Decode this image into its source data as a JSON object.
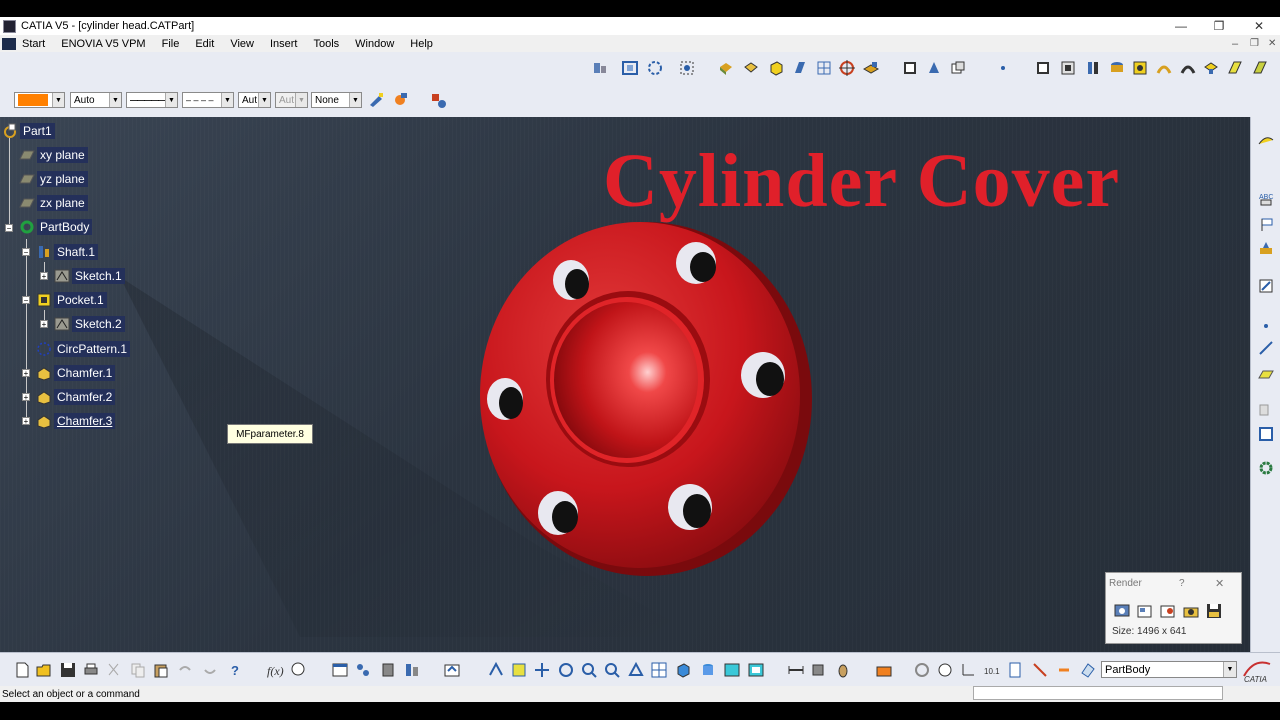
{
  "window": {
    "title": "CATIA V5 - [cylinder head.CATPart]",
    "controls": [
      "—",
      "❐",
      "✕"
    ],
    "doc_controls": [
      "–",
      "❐",
      "✕"
    ]
  },
  "menu": [
    "Start",
    "ENOVIA V5 VPM",
    "File",
    "Edit",
    "View",
    "Insert",
    "Tools",
    "Window",
    "Help"
  ],
  "graphic_props": {
    "color": "#ff8000",
    "transparency": "Auto",
    "linetype_solid": "——————",
    "linetype_dashed": "– – – –",
    "thickness": "Aut",
    "point_symbol": "Aut",
    "layer": "None"
  },
  "tree": {
    "root": "Part1",
    "items": [
      {
        "label": "xy plane",
        "icon": "plane-icon"
      },
      {
        "label": "yz plane",
        "icon": "plane-icon"
      },
      {
        "label": "zx plane",
        "icon": "plane-icon"
      },
      {
        "label": "PartBody",
        "icon": "partbody-icon"
      },
      {
        "label": "Shaft.1",
        "icon": "shaft-icon"
      },
      {
        "label": "Sketch.1",
        "icon": "sketch-icon"
      },
      {
        "label": "Pocket.1",
        "icon": "pocket-icon"
      },
      {
        "label": "Sketch.2",
        "icon": "sketch-icon"
      },
      {
        "label": "CircPattern.1",
        "icon": "pattern-icon"
      },
      {
        "label": "Chamfer.1",
        "icon": "chamfer-icon"
      },
      {
        "label": "Chamfer.2",
        "icon": "chamfer-icon"
      },
      {
        "label": "Chamfer.3",
        "icon": "chamfer-icon"
      }
    ]
  },
  "tooltip": "MFparameter.8",
  "overlay_title": "Cylinder Cover",
  "render_panel": {
    "title": "Render",
    "help": "?",
    "close": "✕",
    "size": "Size: 1496 x 641"
  },
  "current_body": "PartBody",
  "status": "Select an object or a command",
  "colors": {
    "part_red": "#c8161c",
    "title_red": "#e0202a",
    "tree_highlight": "#24305a",
    "background": "#2b3440"
  }
}
